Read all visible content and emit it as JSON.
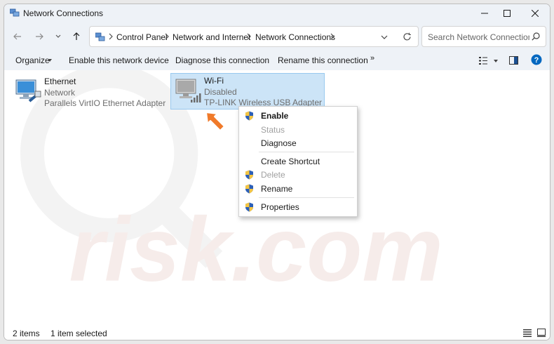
{
  "window": {
    "title": "Network Connections",
    "minimize_icon": "minimize-icon",
    "maximize_icon": "maximize-icon",
    "close_icon": "close-icon"
  },
  "navigation": {
    "back_icon": "arrow-left-icon",
    "forward_icon": "arrow-right-icon",
    "recent_icon": "chevron-down-icon",
    "up_icon": "arrow-up-icon",
    "breadcrumbs": [
      "Control Panel",
      "Network and Internet",
      "Network Connections"
    ],
    "refresh_icon": "refresh-icon",
    "search_placeholder": "Search Network Connections"
  },
  "commands": {
    "organize": "Organize",
    "enable": "Enable this network device",
    "diagnose": "Diagnose this connection",
    "rename": "Rename this connection",
    "more": "»"
  },
  "items": [
    {
      "name": "Ethernet",
      "status": "Network",
      "adapter": "Parallels VirtIO Ethernet Adapter",
      "selected": false
    },
    {
      "name": "Wi-Fi",
      "status": "Disabled",
      "adapter": "TP-LINK Wireless USB Adapter",
      "selected": true
    }
  ],
  "context_menu": {
    "items": [
      {
        "label": "Enable",
        "shield": true,
        "disabled": false,
        "bold": true
      },
      {
        "label": "Status",
        "shield": false,
        "disabled": true,
        "bold": false
      },
      {
        "label": "Diagnose",
        "shield": false,
        "disabled": false,
        "bold": false
      },
      {
        "label": "Create Shortcut",
        "shield": false,
        "disabled": false,
        "bold": false
      },
      {
        "label": "Delete",
        "shield": true,
        "disabled": true,
        "bold": false
      },
      {
        "label": "Rename",
        "shield": true,
        "disabled": false,
        "bold": false
      },
      {
        "label": "Properties",
        "shield": true,
        "disabled": false,
        "bold": false
      }
    ]
  },
  "status_bar": {
    "item_count": "2 items",
    "selection": "1 item selected"
  },
  "colors": {
    "accent": "#0067c0",
    "selection_bg": "#cce4f7",
    "arrow": "#f07a2a",
    "watermark": "#f2f2f2"
  },
  "watermark_text": "risk.com"
}
